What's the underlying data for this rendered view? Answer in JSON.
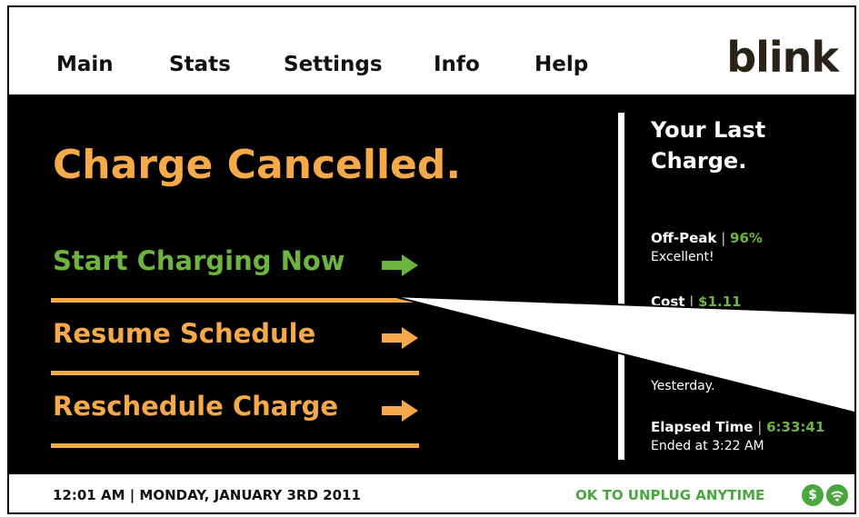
{
  "nav": {
    "tabs": [
      "Main",
      "Stats",
      "Settings",
      "Info",
      "Help"
    ],
    "active_tab": "Main",
    "logo": "blink"
  },
  "main": {
    "title": "Charge Cancelled.",
    "actions": [
      {
        "label": "Start Charging Now",
        "color": "#6db33f"
      },
      {
        "label": "Resume Schedule",
        "color": "#f5a948"
      },
      {
        "label": "Reschedule Charge",
        "color": "#f5a948"
      }
    ]
  },
  "last_charge": {
    "title_line1": "Your Last",
    "title_line2": "Charge.",
    "offpeak_label": "Off-Peak",
    "offpeak_value": "96%",
    "offpeak_note": "Excellent!",
    "cost_label": "Cost",
    "cost_value": "$1.11",
    "partial_date": "Yesterday.",
    "elapsed_label": "Elapsed Time",
    "elapsed_value": "6:33:41",
    "ended": "Ended at 3:22 AM"
  },
  "footer": {
    "datetime": "12:01 AM | MONDAY, JANUARY 3RD 2011",
    "status": "OK TO UNPLUG ANYTIME",
    "icons": [
      "dollar-icon",
      "wifi-icon"
    ]
  },
  "colors": {
    "orange": "#f5a948",
    "green": "#6db33f",
    "background": "#000000"
  }
}
